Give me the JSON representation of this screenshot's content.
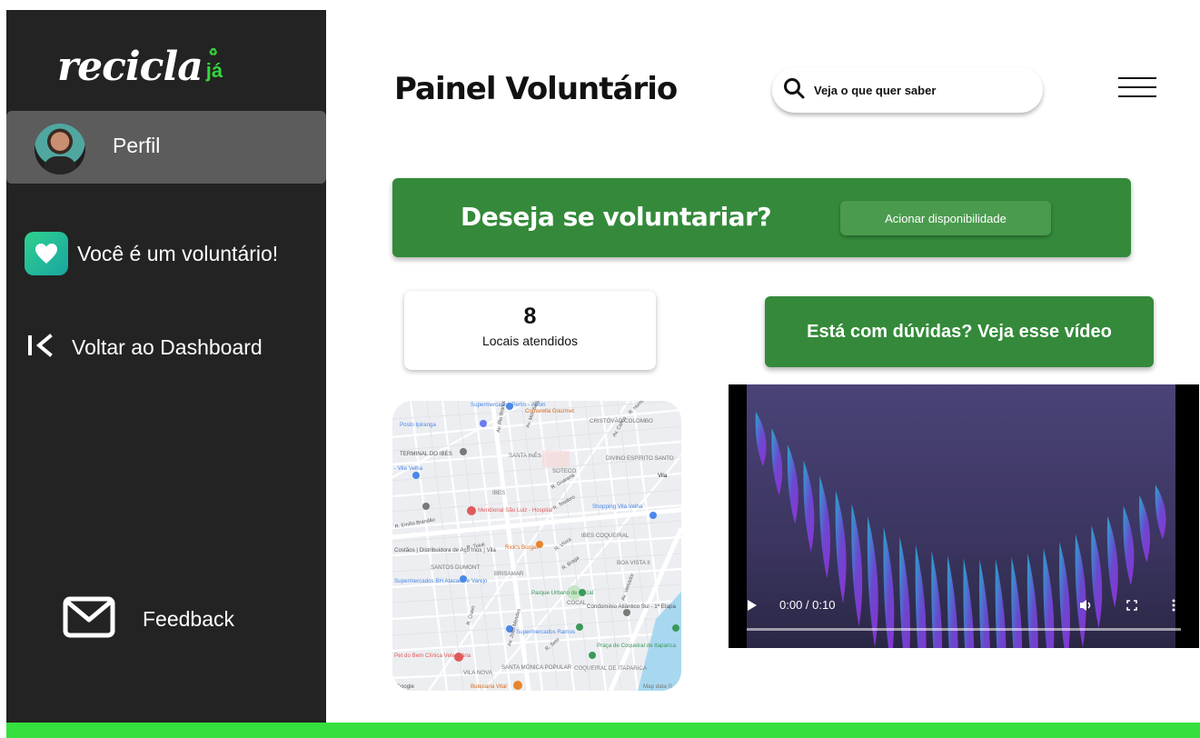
{
  "brand": {
    "name": "recicla",
    "accent": "já",
    "primary_color": "#348a3a",
    "accent_color": "#35d63c"
  },
  "sidebar": {
    "profile_label": "Perfil",
    "volunteer_label": "Você é um voluntário!",
    "back_label": "Voltar ao Dashboard",
    "feedback_label": "Feedback"
  },
  "header": {
    "title": "Painel Voluntário",
    "search_placeholder": "Veja o que quer saber"
  },
  "banner": {
    "title": "Deseja se voluntariar?",
    "button_label": "Acionar disponibilidade"
  },
  "stats": {
    "value": "8",
    "label": "Locais atendidos"
  },
  "help": {
    "label": "Está com dúvidas? Veja esse vídeo"
  },
  "map": {
    "labels": [
      "Supermercados Perim - Aribiri",
      "Comarella Gourmet",
      "Posto Ipiranga",
      "CRISTÓVÃO COLOMBO",
      "TERMINAL DO IBES",
      "SANTA INÊS",
      "DIVINO ESPÍRITO SANTO",
      "Vila",
      "- Vila Velha",
      "SOTECO",
      "IBES",
      "Shopping Vila Velha",
      "Meridional São Luiz - Hospital",
      "Rick's Burger",
      "IBES COQUEIRAL",
      "Costãos | Distribuidora de Aço Inox | Vila",
      "BOA VISTA II",
      "SANTOS DUMONT",
      "Supermercados BH Atacado e Varejo",
      "BRISAMAR",
      "Parque Urbano de Cocal",
      "COCAL",
      "Condominio Atlântico Sul - 1ª Etapa",
      "Supermercados Ramos",
      "Pet do Bem Clínica Veterinária",
      "Praça de Coqueiral de Itaparica",
      "SANTA MÔNICA POPULAR",
      "COQUEIRAL DE ITAPARICA",
      "VILA NOVA",
      "Butecaria Vital",
      "Google",
      "Map data ©"
    ],
    "streets": [
      "Av. Rio Branco",
      "Av. Min. Salgado Filho",
      "R. Humaitá",
      "R. Guaraná",
      "R. Teodoro",
      "Av. Carlos",
      "R. Emílio Brandão",
      "R. Tuiuti",
      "R. Viúva",
      "R. Braga",
      "R. Cravo",
      "Av. João Mendes",
      "Av. Vereador",
      "R. Sete"
    ]
  },
  "video": {
    "time": "0:00 / 0:10",
    "progress": 0
  }
}
